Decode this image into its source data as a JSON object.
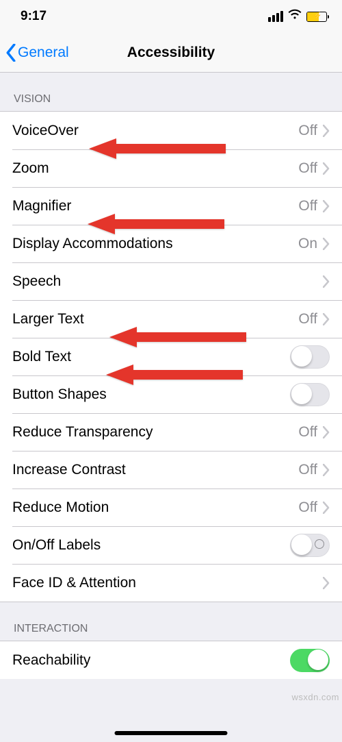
{
  "status": {
    "time": "9:17"
  },
  "nav": {
    "back": "General",
    "title": "Accessibility"
  },
  "sections": {
    "vision": {
      "header": "VISION",
      "rows": {
        "voiceover": {
          "label": "VoiceOver",
          "value": "Off"
        },
        "zoom": {
          "label": "Zoom",
          "value": "Off"
        },
        "magnifier": {
          "label": "Magnifier",
          "value": "Off"
        },
        "display_accommodations": {
          "label": "Display Accommodations",
          "value": "On"
        },
        "speech": {
          "label": "Speech"
        },
        "larger_text": {
          "label": "Larger Text",
          "value": "Off"
        },
        "bold_text": {
          "label": "Bold Text",
          "switch": false
        },
        "button_shapes": {
          "label": "Button Shapes",
          "switch": false
        },
        "reduce_transparency": {
          "label": "Reduce Transparency",
          "value": "Off"
        },
        "increase_contrast": {
          "label": "Increase Contrast",
          "value": "Off"
        },
        "reduce_motion": {
          "label": "Reduce Motion",
          "value": "Off"
        },
        "on_off_labels": {
          "label": "On/Off Labels",
          "switch": false
        },
        "face_id_attention": {
          "label": "Face ID & Attention"
        }
      }
    },
    "interaction": {
      "header": "INTERACTION",
      "rows": {
        "reachability": {
          "label": "Reachability",
          "switch": true
        }
      }
    }
  },
  "watermark": "wsxdn.com"
}
